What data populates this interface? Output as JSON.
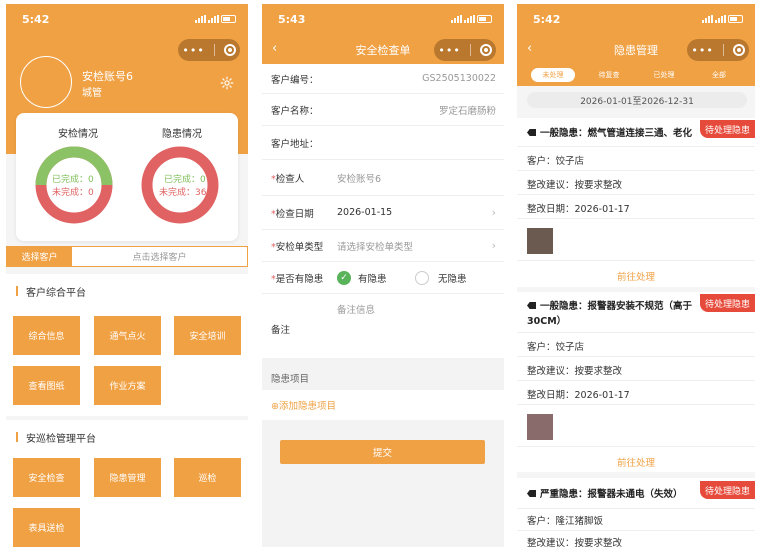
{
  "p1": {
    "time": "5:42",
    "account_name": "安检账号6",
    "account_role": "城管",
    "inspect_title": "安检情况",
    "hazard_title": "隐患情况",
    "inspect_done": "已完成：0",
    "inspect_undone": "未完成：0",
    "hazard_done": "已完成：0",
    "hazard_undone": "未完成：364",
    "inspect_done_fraction": 0.5,
    "hazard_done_fraction": 0.0,
    "select_label": "选择客户",
    "select_placeholder": "点击选择客户",
    "section1": "客户综合平台",
    "tiles1": [
      "综合信息",
      "通气点火",
      "安全培训",
      "查看图纸",
      "作业方案"
    ],
    "section2": "安巡检管理平台",
    "tiles2": [
      "安全检查",
      "隐患管理",
      "巡检",
      "表具送检"
    ],
    "icons": {
      "gear": "settings-icon",
      "capsule": "menu-capsule"
    }
  },
  "p2": {
    "time": "5:43",
    "title": "安全检查单",
    "customer_no_label": "客户编号：",
    "customer_no": "GS2505130022",
    "customer_name_label": "客户名称：",
    "customer_name": "罗定石磨肠粉",
    "customer_addr_label": "客户地址：",
    "inspector_label": "检查人",
    "inspector": "安检账号6",
    "date_label": "检查日期",
    "date": "2026-01-15",
    "type_label": "安检单类型",
    "type_placeholder": "请选择安检单类型",
    "has_hazard_label": "是否有隐患",
    "opt_yes": "有隐患",
    "opt_no": "无隐患",
    "remark_label": "备注",
    "remark_placeholder": "备注信息",
    "hazard_items_label": "隐患项目",
    "add_hazard": "⊕添加隐患项目",
    "submit": "提交",
    "required_mark": "*"
  },
  "p3": {
    "time": "5:42",
    "title": "隐患管理",
    "tabs": [
      "未处理",
      "待复查",
      "已处理",
      "全部"
    ],
    "date_range": "2026-01-01至2026-12-31",
    "cards": [
      {
        "title": "一般隐患：燃气管道连接三通、老化",
        "badge": "待处理隐患",
        "customer": "客户：饺子店",
        "advice": "整改建议：按要求整改",
        "deadline": "整改日期：2026-01-17",
        "action": "前往处理"
      },
      {
        "title": "一般隐患：报警器安装不规范（高于",
        "title2": "30CM）",
        "badge": "待处理隐患",
        "customer": "客户：饺子店",
        "advice": "整改建议：按要求整改",
        "deadline": "整改日期：2026-01-17",
        "action": "前往处理"
      },
      {
        "title": "严重隐患：报警器未通电（失效）",
        "badge": "待处理隐患",
        "customer": "客户：隆江猪脚饭",
        "advice": "整改建议：按要求整改"
      }
    ]
  },
  "colors": {
    "accent": "#f0a144",
    "green": "#7fbf5a",
    "red": "#e06262",
    "badge": "#e64a3b"
  }
}
